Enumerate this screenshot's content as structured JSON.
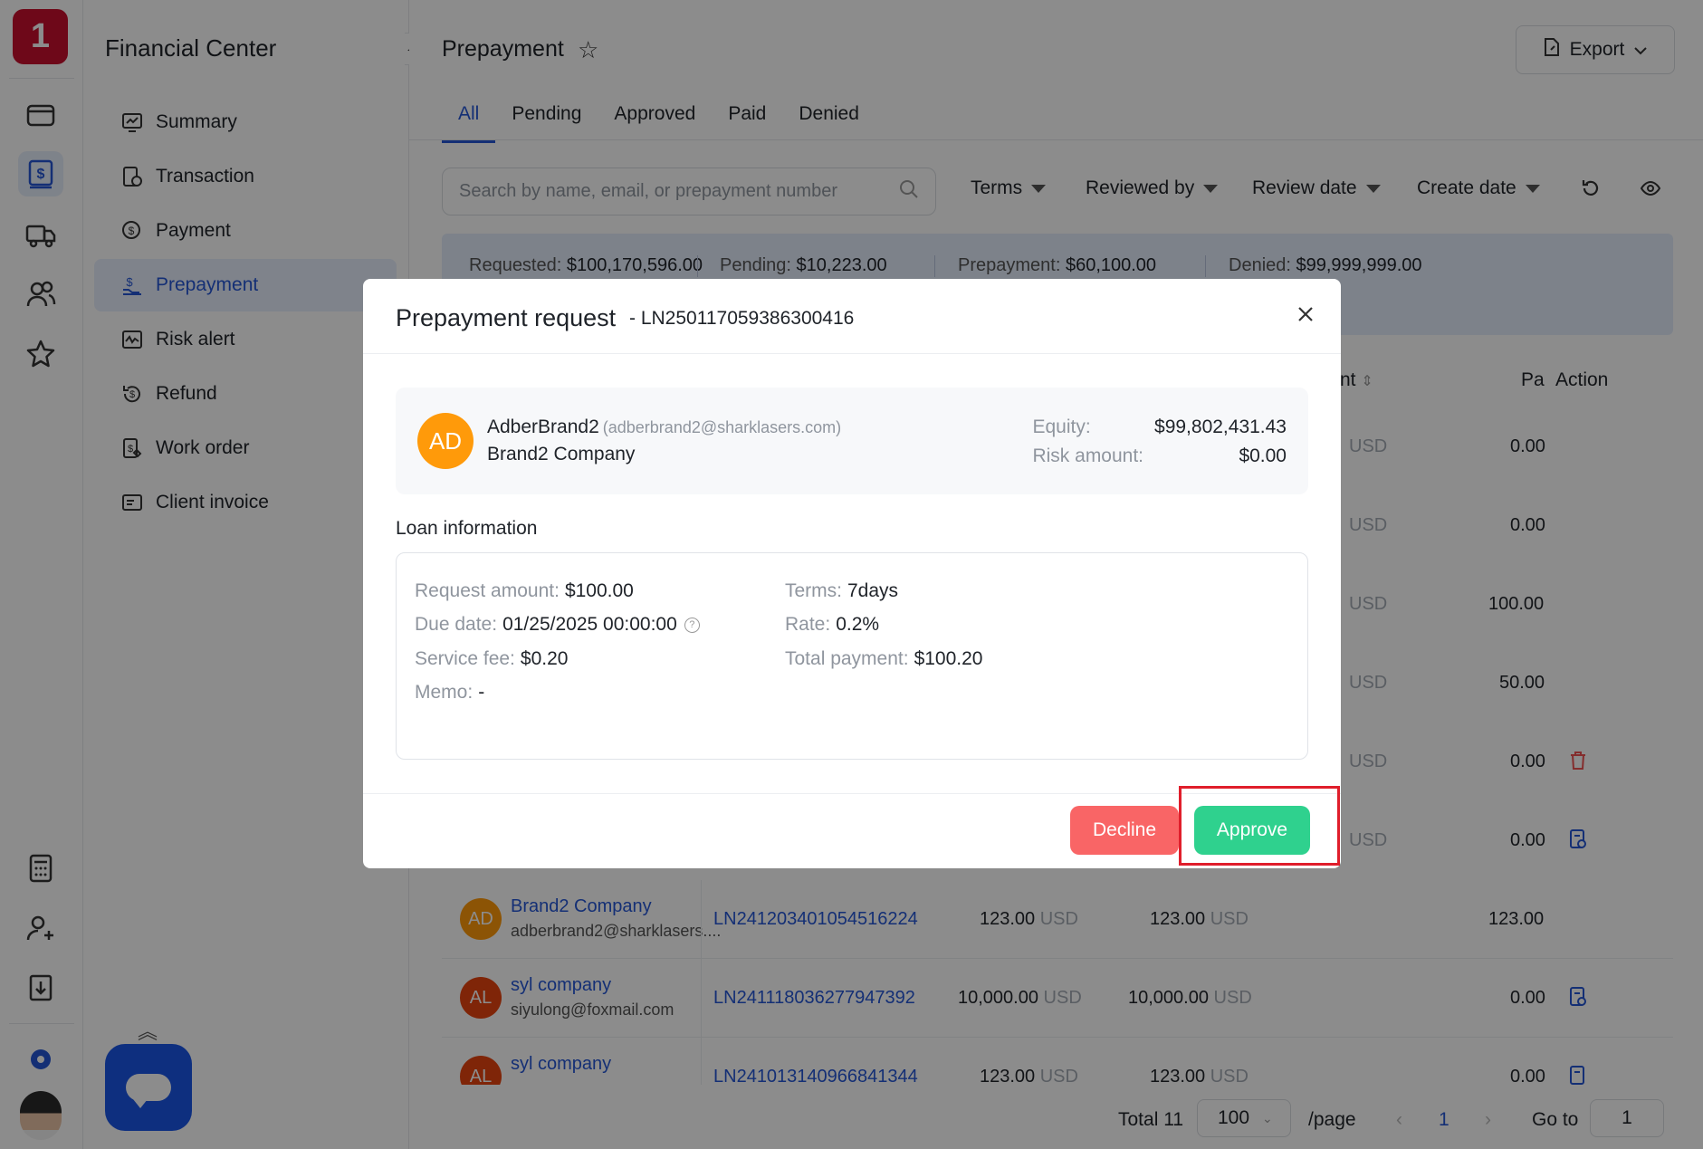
{
  "app": {
    "logo_text": "1",
    "brand_color": "#c8102e",
    "accent_color": "#2557d6"
  },
  "rail": {
    "icons": [
      "wallet-icon",
      "dollar-document-icon",
      "truck-icon",
      "users-icon",
      "star-icon",
      "calculator-icon",
      "add-user-icon",
      "download-document-icon",
      "gear-icon"
    ]
  },
  "sidebar": {
    "title": "Financial Center",
    "items": [
      {
        "label": "Summary",
        "icon": "chart-icon"
      },
      {
        "label": "Transaction",
        "icon": "transaction-icon"
      },
      {
        "label": "Payment",
        "icon": "payment-icon"
      },
      {
        "label": "Prepayment",
        "icon": "prepayment-icon",
        "active": true
      },
      {
        "label": "Risk alert",
        "icon": "risk-icon"
      },
      {
        "label": "Refund",
        "icon": "refund-icon"
      },
      {
        "label": "Work order",
        "icon": "work-order-icon"
      },
      {
        "label": "Client invoice",
        "icon": "invoice-icon"
      }
    ]
  },
  "header": {
    "title": "Prepayment",
    "export_label": "Export"
  },
  "tabs": [
    "All",
    "Pending",
    "Approved",
    "Paid",
    "Denied"
  ],
  "search": {
    "placeholder": "Search by name, email, or prepayment number"
  },
  "filters": [
    "Terms",
    "Reviewed by",
    "Review date",
    "Create date"
  ],
  "summary": {
    "requested_label": "Requested:",
    "requested": "$100,170,596.00",
    "pending_label": "Pending:",
    "pending": "$10,223.00",
    "prepayment_label": "Prepayment:",
    "prepayment": "$60,100.00",
    "denied_label": "Denied:",
    "denied": "$99,999,999.00"
  },
  "table": {
    "headers": {
      "amount_partial": "nt",
      "paid_partial": "Pa",
      "action": "Action"
    },
    "rows_behind": [
      {
        "amount_cur": "USD",
        "paid": "0.00"
      },
      {
        "amount_cur": "USD",
        "paid": "0.00"
      },
      {
        "amount_cur": "USD",
        "paid": "100.00"
      },
      {
        "amount_cur": "USD",
        "paid": "50.00"
      },
      {
        "amount_cur": "USD",
        "paid": "0.00"
      },
      {
        "amount_cur": "USD",
        "paid": "0.00"
      }
    ],
    "rows": [
      {
        "initials": "AD",
        "avatar_color": "#ff9a0a",
        "company": "Brand2 Company",
        "email": "adberbrand2@sharklasers....",
        "number": "LN241203401054516224",
        "request": "123.00",
        "request_cur": "USD",
        "total": "123.00",
        "total_cur": "USD",
        "paid": "123.00"
      },
      {
        "initials": "AL",
        "avatar_color": "#e8440f",
        "company": "syl company",
        "email": "siyulong@foxmail.com",
        "number": "LN241118036277947392",
        "request": "10,000.00",
        "request_cur": "USD",
        "total": "10,000.00",
        "total_cur": "USD",
        "paid": "0.00"
      },
      {
        "initials": "AL",
        "avatar_color": "#e8440f",
        "company": "syl company",
        "email": "",
        "number": "LN241013140966841344",
        "request": "123.00",
        "request_cur": "USD",
        "total": "123.00",
        "total_cur": "USD",
        "paid": "0.00"
      }
    ]
  },
  "pager": {
    "total": "Total 11",
    "page_size": "100",
    "per_page": "/page",
    "current": "1",
    "goto_label": "Go to",
    "goto_value": "1"
  },
  "modal": {
    "title": "Prepayment request",
    "number": "- LN250117059386300416",
    "user": {
      "initials": "AD",
      "name": "AdberBrand2",
      "email": "(adberbrand2@sharklasers.com)",
      "company": "Brand2 Company",
      "equity_label": "Equity:",
      "equity": "$99,802,431.43",
      "risk_label": "Risk amount:",
      "risk": "$0.00"
    },
    "loan_title": "Loan information",
    "loan": {
      "request_amount_label": "Request amount:",
      "request_amount": "$100.00",
      "terms_label": "Terms:",
      "terms": "7days",
      "due_date_label": "Due date:",
      "due_date": "01/25/2025 00:00:00",
      "rate_label": "Rate:",
      "rate": "0.2%",
      "service_fee_label": "Service fee:",
      "service_fee": "$0.20",
      "total_payment_label": "Total payment:",
      "total_payment": "$100.20",
      "memo_label": "Memo:",
      "memo": "-"
    },
    "decline_label": "Decline",
    "approve_label": "Approve",
    "decline_color": "#f96566",
    "approve_color": "#2fd18e"
  }
}
